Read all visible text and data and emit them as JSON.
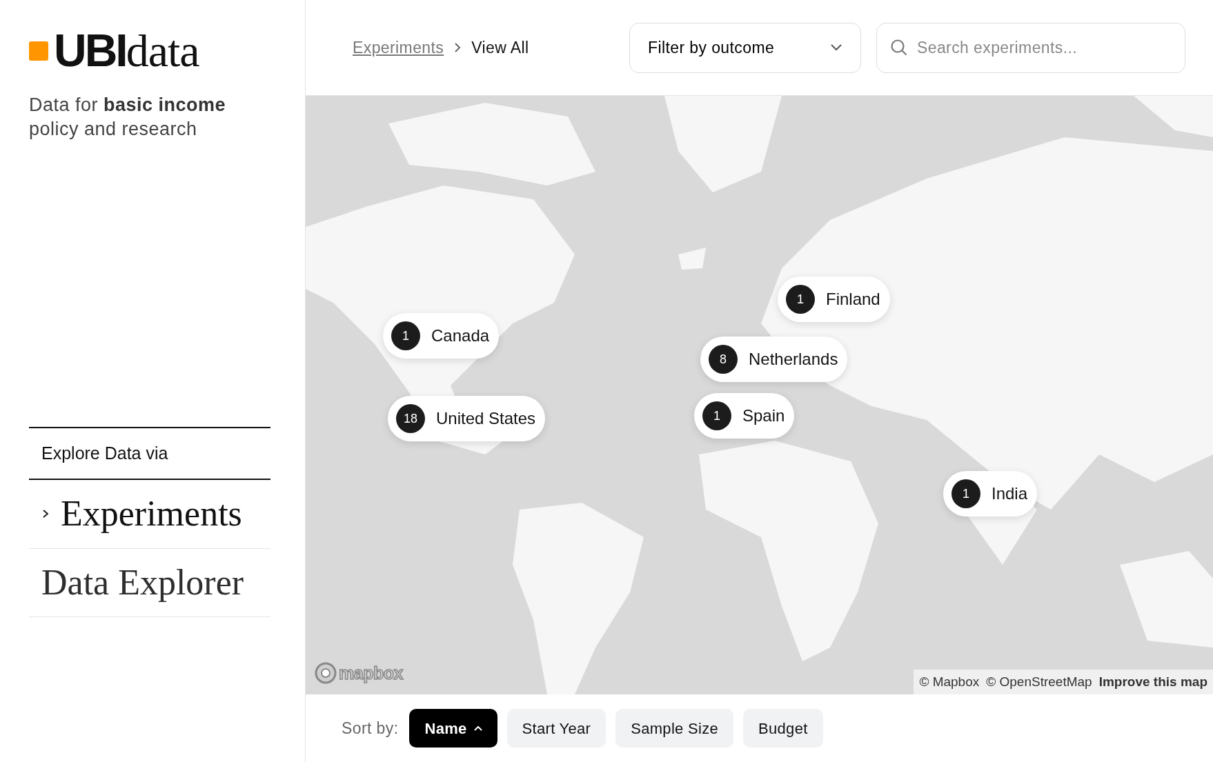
{
  "logo": "**UBI**data",
  "tagline": "Data for **basic income** policy and research",
  "nav": {
    "heading": "Explore Data via",
    "items": [
      {
        "label": "Experiments",
        "selected": true
      },
      {
        "label": "Data Explorer",
        "selected": false
      }
    ]
  },
  "breadcrumb": [
    "Experiments",
    "View All"
  ],
  "filter": {
    "label": "Filter by outcome"
  },
  "search": {
    "placeholder": "Search experiments..."
  },
  "map": {
    "kind": "picture",
    "markers": [
      {
        "count": "1",
        "label": "Canada"
      },
      {
        "count": "18",
        "label": "United States"
      },
      {
        "count": "1",
        "label": "Finland"
      },
      {
        "count": "8",
        "label": "Netherlands"
      },
      {
        "count": "1",
        "label": "Spain"
      },
      {
        "count": "1",
        "label": "India"
      }
    ],
    "logo": "mapbox",
    "attribution": [
      "© Mapbox",
      "© OpenStreetMap"
    ],
    "improve_link": "Improve this map"
  },
  "sort": {
    "label": "Sort by:",
    "options": [
      {
        "label": "Name",
        "selected": true
      },
      {
        "label": "Start Year",
        "selected": false
      },
      {
        "label": "Sample Size",
        "selected": false
      },
      {
        "label": "Budget",
        "selected": false
      }
    ]
  }
}
